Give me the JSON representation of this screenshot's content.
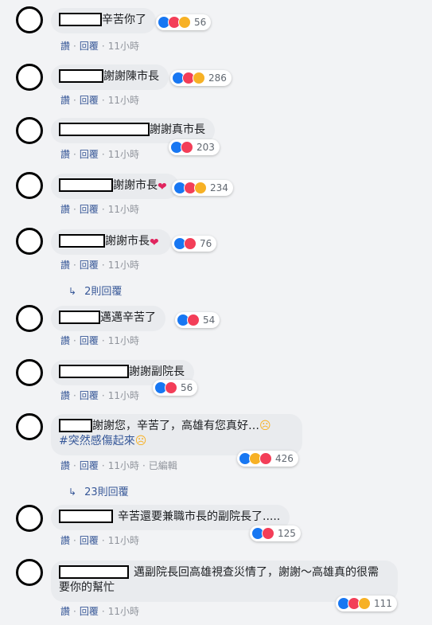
{
  "actions": {
    "like": "讚",
    "reply": "回覆",
    "edited": "已編輯"
  },
  "comments": [
    {
      "text": "辛苦你了",
      "time": "11小時",
      "reactions": [
        "like",
        "love",
        "haha"
      ],
      "count": "56"
    },
    {
      "text": "謝謝陳市長",
      "time": "11小時",
      "reactions": [
        "like",
        "love",
        "haha"
      ],
      "count": "286"
    },
    {
      "text": "謝謝真市長",
      "time": "11小時",
      "reactions": [
        "like",
        "love"
      ],
      "count": "203"
    },
    {
      "text": "謝謝市長",
      "time": "11小時",
      "reactions": [
        "like",
        "love",
        "sad"
      ],
      "count": "234"
    },
    {
      "text": "謝謝市長",
      "time": "11小時",
      "reactions": [
        "like",
        "love"
      ],
      "count": "76"
    },
    {
      "text": "邁邁辛苦了",
      "time": "11小時",
      "reactions": [
        "like",
        "love"
      ],
      "count": "54"
    },
    {
      "text": "謝謝副院長",
      "time": "11小時",
      "reactions": [
        "like",
        "love"
      ],
      "count": "56"
    },
    {
      "text": "謝謝您，辛苦了，高雄有您真好…",
      "hashtag": "#突然感傷起來",
      "time": "11小時",
      "reactions": [
        "like",
        "sad",
        "love"
      ],
      "count": "426"
    },
    {
      "text": "辛苦還要兼職市長的副院長了.....",
      "time": "11小時",
      "reactions": [
        "like",
        "love"
      ],
      "count": "125"
    },
    {
      "text": "邁副院長回高雄視查災情了，謝謝～高雄真的很需要你的幫忙",
      "time": "11小時",
      "reactions": [
        "like",
        "love",
        "sad"
      ],
      "count": "111"
    }
  ],
  "reply_threads": [
    {
      "label": "2則回覆"
    },
    {
      "label": "23則回覆"
    }
  ]
}
